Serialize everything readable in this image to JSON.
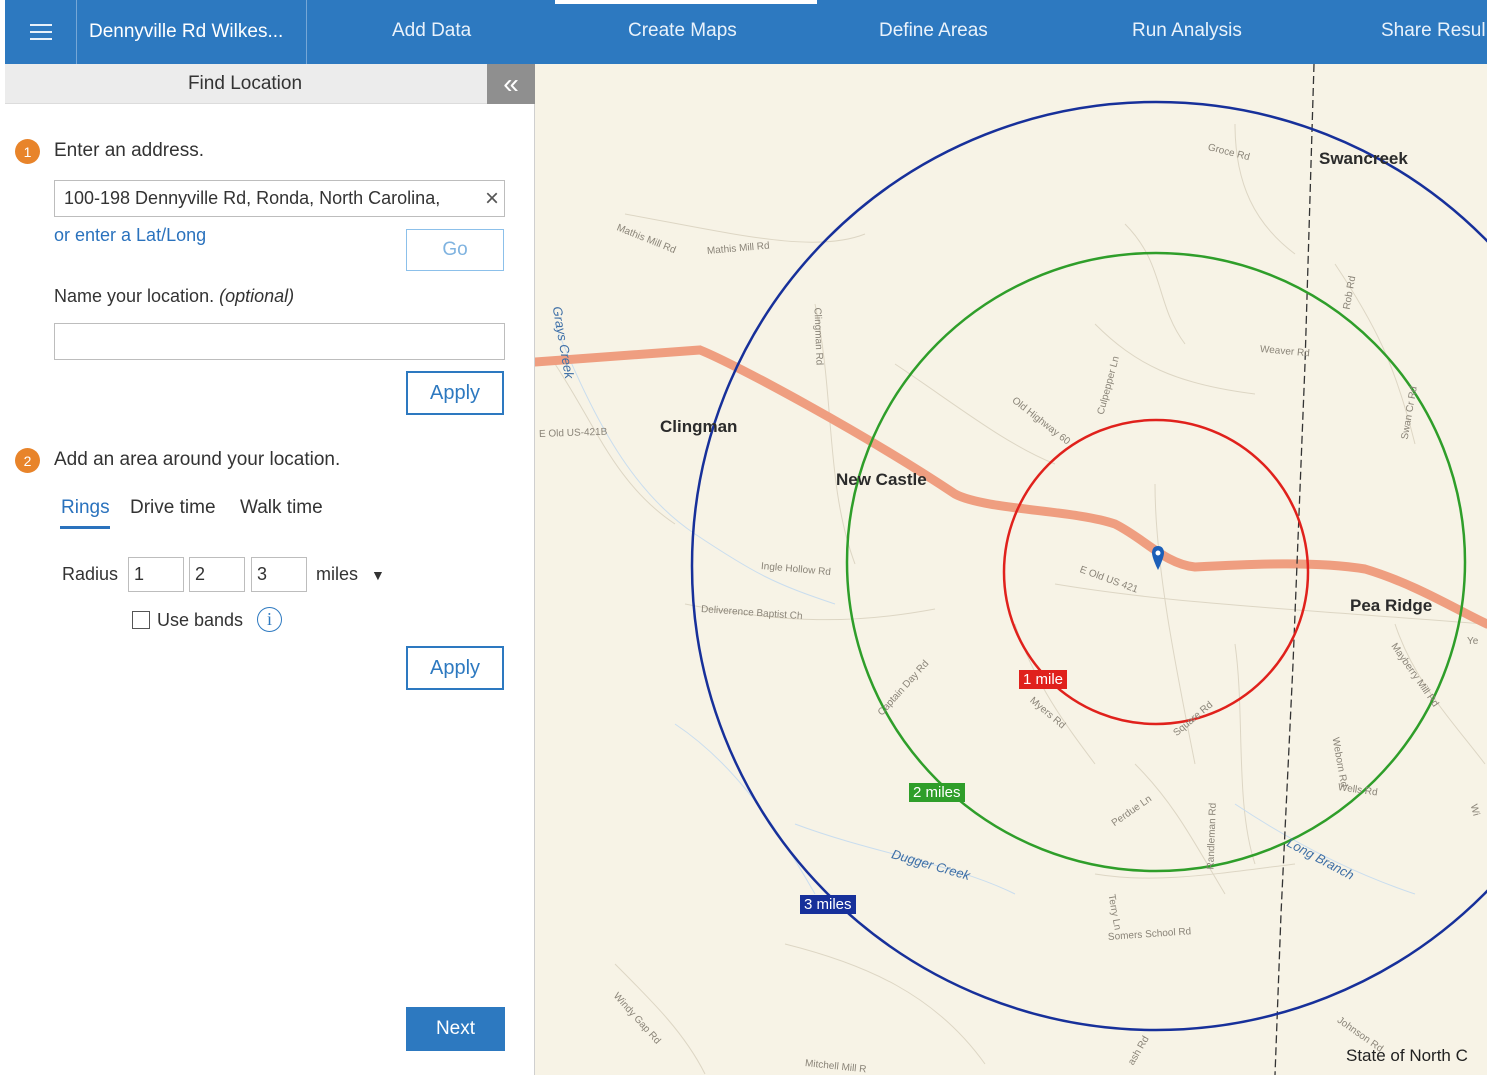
{
  "nav": {
    "project_title": "Dennyville Rd Wilkes...",
    "tabs": [
      "Add Data",
      "Create Maps",
      "Define Areas",
      "Run Analysis",
      "Share Resul"
    ]
  },
  "panel": {
    "title": "Find Location",
    "collapse_glyph": "«",
    "step1": {
      "number": "1",
      "text": "Enter an address."
    },
    "address_value": "100-198 Dennyville Rd, Ronda, North Carolina,",
    "clear_glyph": "×",
    "latlong_link": "or enter a Lat/Long",
    "go_label": "Go",
    "name_label": "Name your location.",
    "name_optional": "(optional)",
    "name_value": "",
    "apply_label": "Apply",
    "step2": {
      "number": "2",
      "text": "Add an area around your location."
    },
    "area_tabs": [
      "Rings",
      "Drive time",
      "Walk time"
    ],
    "active_tab": "Rings",
    "radius_label": "Radius",
    "radius_values": [
      "1",
      "2",
      "3"
    ],
    "units": "miles",
    "use_bands_label": "Use bands",
    "use_bands_checked": false,
    "info_glyph": "i",
    "apply2_label": "Apply",
    "next_label": "Next"
  },
  "map": {
    "places": [
      "Swancreek",
      "Clingman",
      "New Castle",
      "Pea Ridge"
    ],
    "roads": [
      "Groce Rd",
      "Mathis Mill Rd",
      "Mathis Mill Rd",
      "Clingman Rd",
      "Culpepper Ln",
      "Rob Rd",
      "Weaver Rd",
      "Swan Cr Rd",
      "Old Highway 60",
      "E Old US-421B",
      "Ingle Hollow Rd",
      "Deliverence Baptist Ch",
      "Captain Day Rd",
      "E Old US 421",
      "Ye",
      "Mayberry Mill Rd",
      "Myers Rd",
      "Square Rd",
      "Weborn Rd",
      "Wells Rd",
      "Wi",
      "Perdue Ln",
      "Randleman Rd",
      "Terry Ln",
      "Somers School Rd",
      "Windy Gap Rd",
      "Johnson Rd",
      "Mitchell Mill R",
      "ash Rd"
    ],
    "waters": [
      "Grays Creek",
      "Dugger Creek",
      "Long Branch"
    ],
    "ring_labels": [
      "1 mile",
      "2 miles",
      "3 miles"
    ],
    "ring_colors": [
      "#e0211c",
      "#2f9e2a",
      "#17309a"
    ],
    "state_label": "State of North C"
  }
}
